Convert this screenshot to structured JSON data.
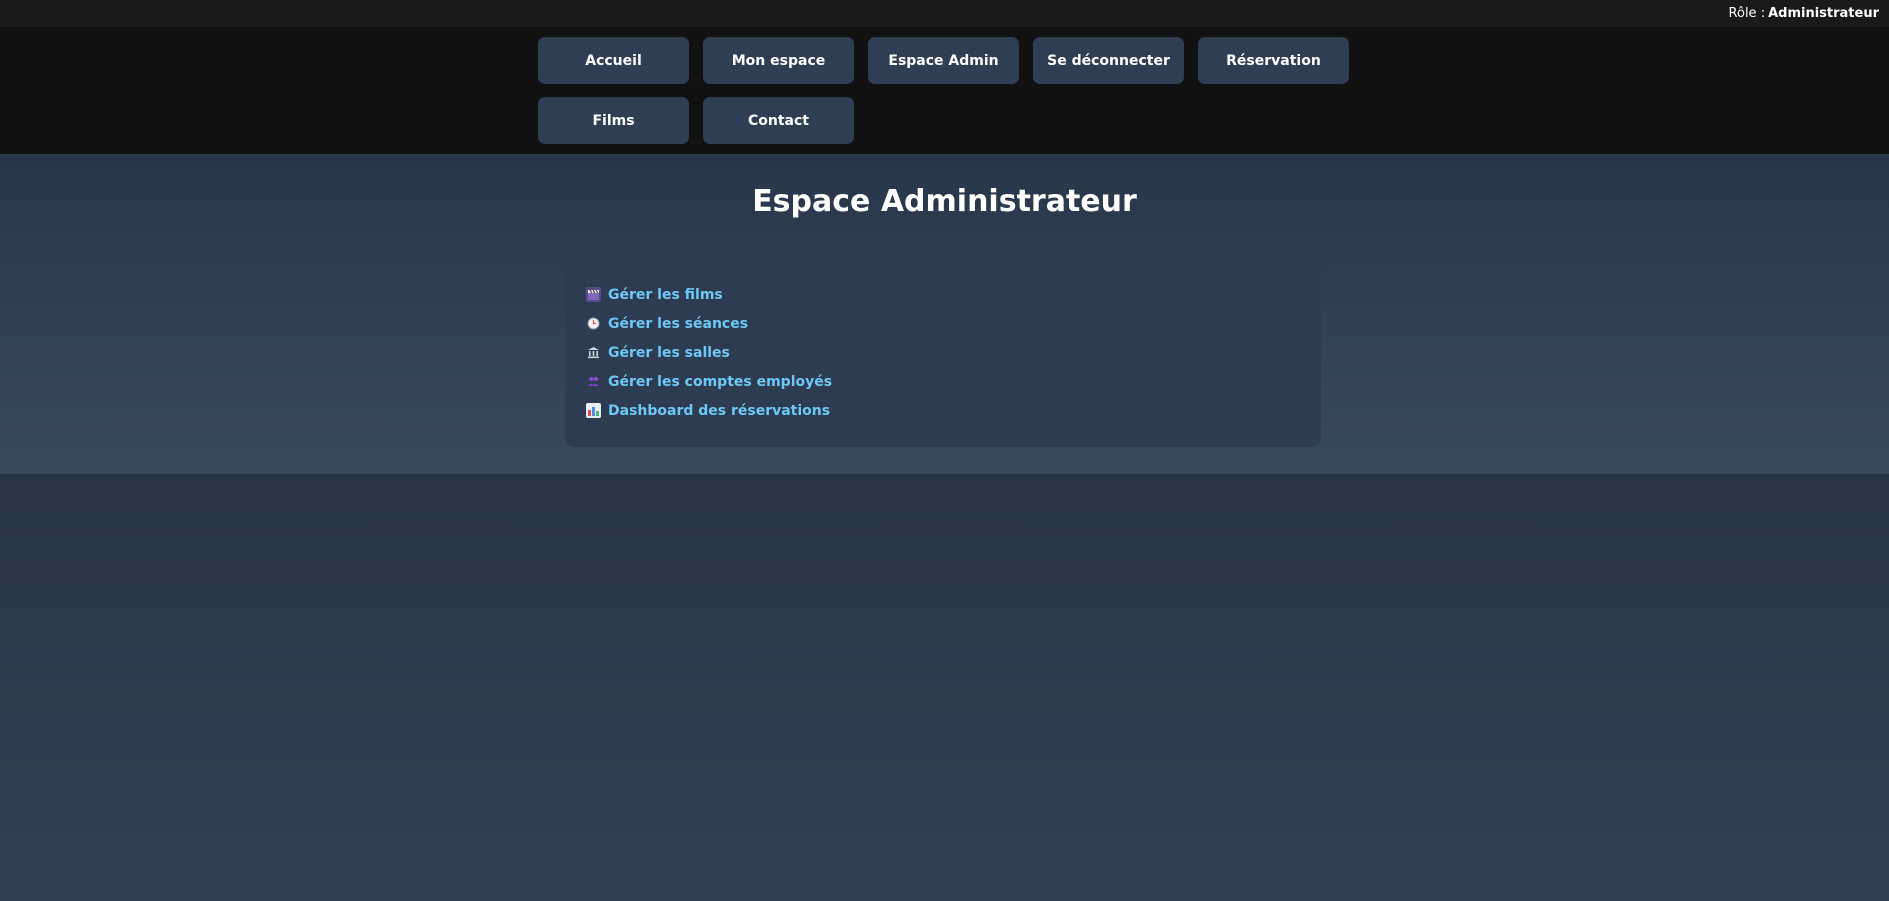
{
  "role_bar": {
    "label": "Rôle :",
    "value": "Administrateur"
  },
  "nav": {
    "items": [
      {
        "label": "Accueil"
      },
      {
        "label": "Mon espace"
      },
      {
        "label": "Espace Admin"
      },
      {
        "label": "Se déconnecter"
      },
      {
        "label": "Réservation"
      },
      {
        "label": "Films"
      },
      {
        "label": "Contact"
      }
    ]
  },
  "main": {
    "title": "Espace Administrateur",
    "links": [
      {
        "icon": "clapperboard-icon",
        "label": "Gérer les films"
      },
      {
        "icon": "clock-icon",
        "label": "Gérer les séances"
      },
      {
        "icon": "classical-building-icon",
        "label": "Gérer les salles"
      },
      {
        "icon": "users-icon",
        "label": "Gérer les comptes employés"
      },
      {
        "icon": "bar-chart-icon",
        "label": "Dashboard des réservations"
      }
    ]
  },
  "colors": {
    "link": "#6ec8f5",
    "nav_button": "#2f3e52",
    "nav_bg": "#111111",
    "card_bg": "#2d3c51"
  }
}
